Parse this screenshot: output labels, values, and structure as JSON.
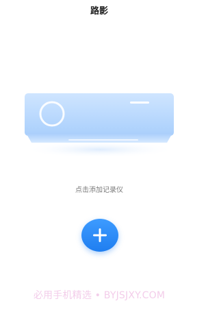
{
  "header": {
    "title": "路影"
  },
  "empty_state": {
    "hint": "点击添加记录仪"
  },
  "add_button": {
    "icon": "plus-icon"
  },
  "watermark": {
    "text": "必用手机精选 • BYJSJXY.COM"
  },
  "colors": {
    "accent": "#2a8bf8",
    "device_light": "#c8e2ff",
    "device_dark": "#9fc8fb",
    "watermark": "#f3cdea"
  }
}
